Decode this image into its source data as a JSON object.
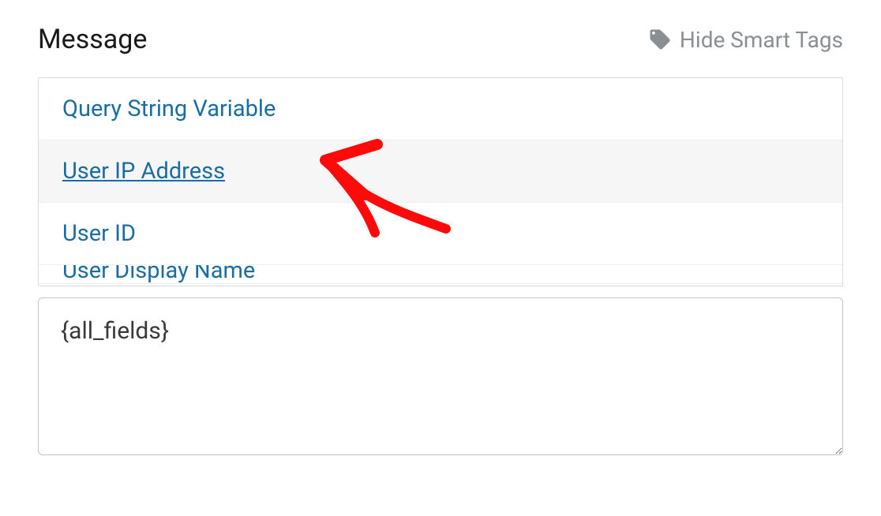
{
  "header": {
    "title": "Message",
    "toggle_label": "Hide Smart Tags"
  },
  "smart_tags": {
    "items": [
      {
        "label": "Query String Variable"
      },
      {
        "label": "User IP Address"
      },
      {
        "label": "User ID"
      },
      {
        "label": "User Display Name"
      }
    ],
    "highlighted_index": 1
  },
  "message": {
    "value": "{all_fields}"
  },
  "colors": {
    "link": "#1a6da4",
    "muted": "#8a8f94",
    "border": "#dcdcde",
    "highlight_bg": "#f6f6f7",
    "annotation": "#ff0a0a"
  }
}
